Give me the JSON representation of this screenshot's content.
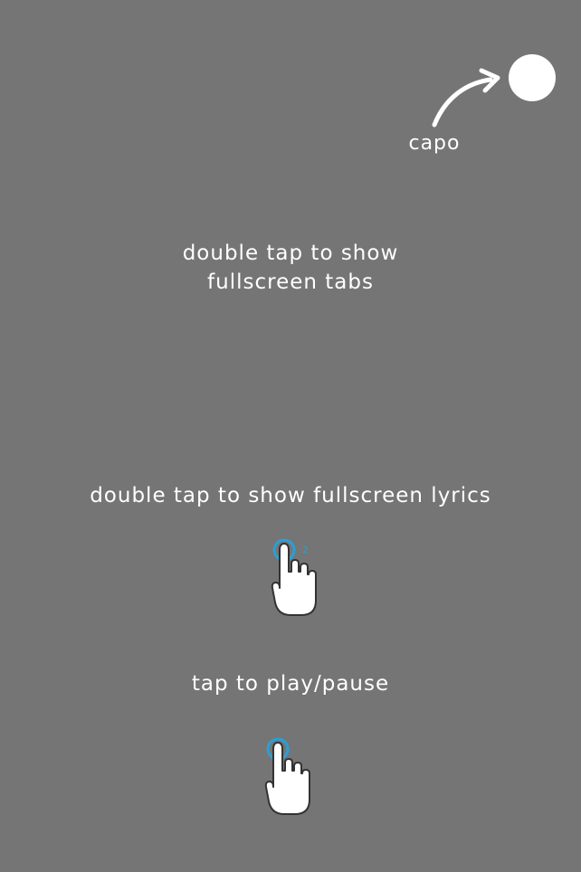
{
  "capo": {
    "label": "capo"
  },
  "hints": {
    "tabs_line1": "double tap to show",
    "tabs_line2": "fullscreen tabs",
    "lyrics": "double tap to show fullscreen lyrics",
    "play_pause": "tap to play/pause"
  },
  "icons": {
    "capo_button": "circle-button",
    "capo_arrow": "curved-arrow-icon",
    "double_tap_gesture": "double-tap-hand-icon",
    "single_tap_gesture": "single-tap-hand-icon"
  },
  "colors": {
    "background": "#757575",
    "text": "#ffffff",
    "accent": "#2a9fd6"
  }
}
